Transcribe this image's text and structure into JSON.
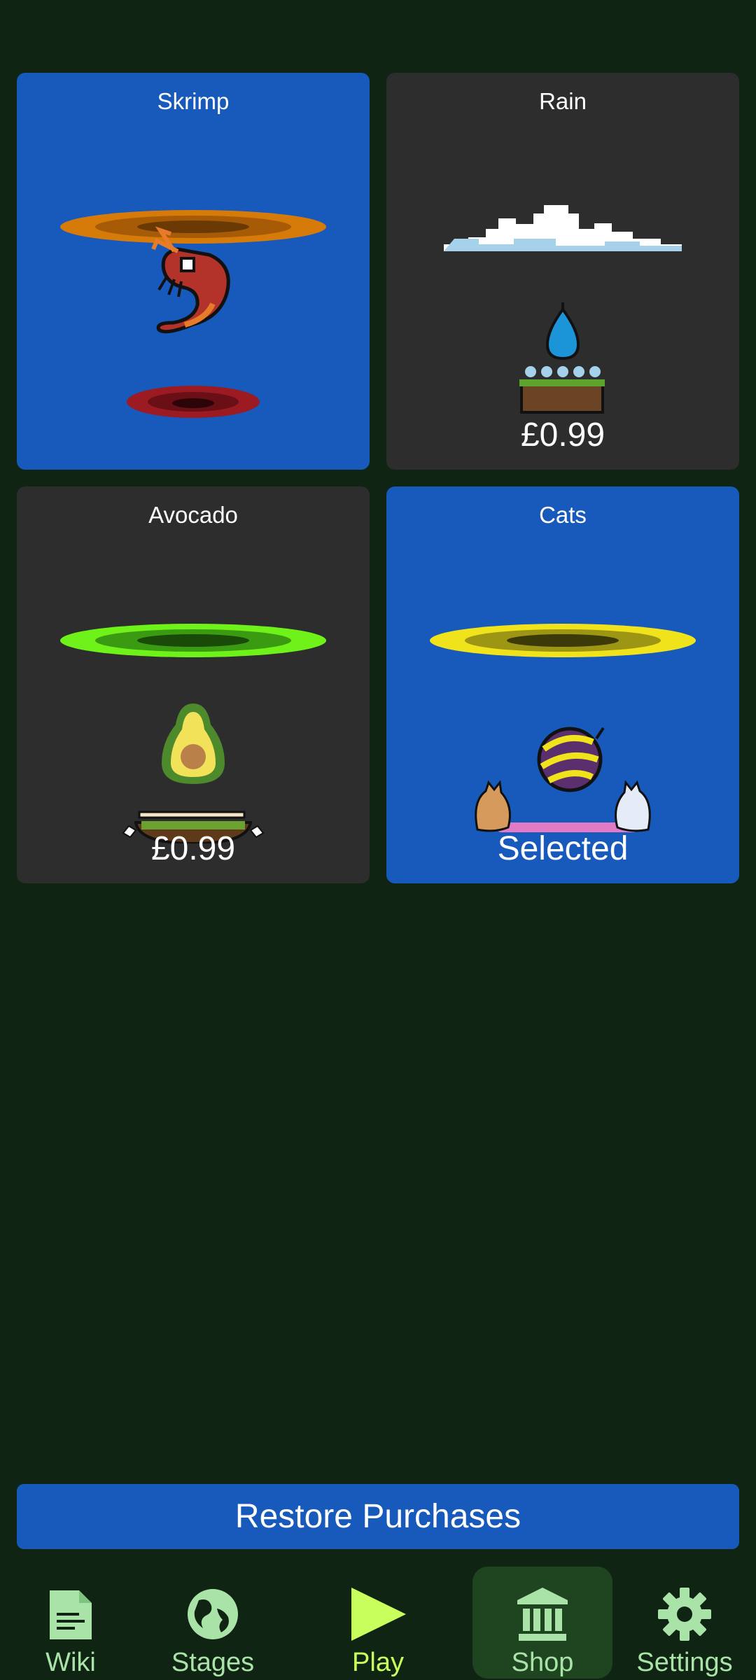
{
  "shop": {
    "items": [
      {
        "name": "Skrimp",
        "footer": "",
        "state": "selected-bg"
      },
      {
        "name": "Rain",
        "footer": "£0.99",
        "state": "locked"
      },
      {
        "name": "Avocado",
        "footer": "£0.99",
        "state": "locked"
      },
      {
        "name": "Cats",
        "footer": "Selected",
        "state": "selected"
      }
    ],
    "restore_label": "Restore Purchases"
  },
  "nav": {
    "items": [
      {
        "label": "Wiki",
        "icon": "document-icon"
      },
      {
        "label": "Stages",
        "icon": "globe-icon"
      },
      {
        "label": "Play",
        "icon": "play-icon"
      },
      {
        "label": "Shop",
        "icon": "bank-icon",
        "active": true
      },
      {
        "label": "Settings",
        "icon": "gear-icon"
      }
    ]
  },
  "colors": {
    "background": "#0f2412",
    "card_selected": "#175abb",
    "card_locked": "#2d2d2d",
    "nav_label": "#a9e3a8",
    "play_accent": "#c8ff5c"
  }
}
